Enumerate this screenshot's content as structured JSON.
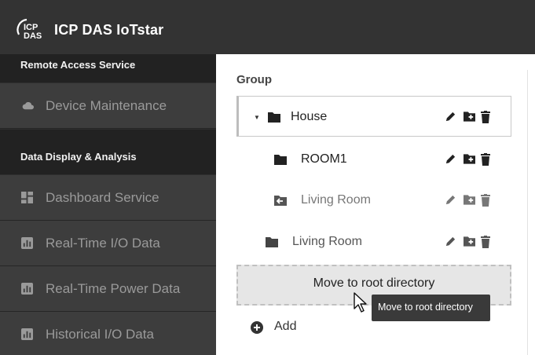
{
  "header": {
    "app_title": "ICP DAS IoTstar",
    "logo_text_top": "ICP",
    "logo_text_bottom": "DAS"
  },
  "sidebar": {
    "sections": [
      {
        "title": "Remote Access Service",
        "items": [
          {
            "label": "Device Maintenance",
            "icon": "cloud-icon"
          }
        ]
      },
      {
        "title": "Data Display & Analysis",
        "items": [
          {
            "label": "Dashboard Service",
            "icon": "dashboard-icon"
          },
          {
            "label": "Real-Time I/O Data",
            "icon": "chart-icon"
          },
          {
            "label": "Real-Time Power Data",
            "icon": "chart-icon"
          },
          {
            "label": "Historical I/O Data",
            "icon": "chart-icon"
          }
        ]
      }
    ]
  },
  "main": {
    "group_title": "Group",
    "tree": [
      {
        "name": "House",
        "level": 0,
        "expanded": true,
        "selected": true,
        "icon": "folder-icon"
      },
      {
        "name": "ROOM1",
        "level": 1,
        "icon": "folder-icon"
      },
      {
        "name": "Living Room",
        "level": 1,
        "faded": true,
        "icon": "folder-move-icon"
      },
      {
        "name": "Living Room",
        "level": 0,
        "icon": "folder-icon"
      }
    ],
    "drop_zone_label": "Move to root directory",
    "tooltip": "Move to root directory",
    "add_label": "Add"
  },
  "colors": {
    "topbar": "#333333",
    "sidebar_item": "#3d3d3d",
    "section_header": "#222222",
    "drop_zone": "#e6e6e6"
  }
}
